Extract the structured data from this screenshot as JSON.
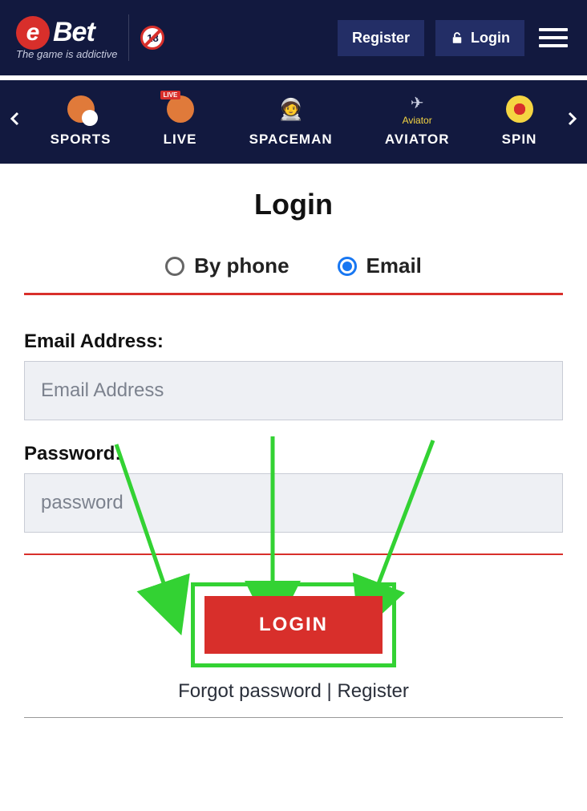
{
  "header": {
    "brand_letter": "e",
    "brand_word": "Bet",
    "brand_tagline": "The game is addictive",
    "age_badge": "18",
    "register_label": "Register",
    "login_label": "Login"
  },
  "nav": {
    "items": [
      {
        "label": "SPORTS"
      },
      {
        "label": "LIVE",
        "live_tag": "LIVE"
      },
      {
        "label": "SPACEMAN"
      },
      {
        "label": "AVIATOR",
        "brand": "Aviator"
      },
      {
        "label": "SPIN"
      }
    ]
  },
  "page": {
    "title": "Login",
    "tabs": {
      "by_phone": "By phone",
      "email": "Email",
      "selected": "email"
    },
    "form": {
      "email_label": "Email Address:",
      "email_placeholder": "Email Address",
      "password_label": "Password:",
      "password_placeholder": "password"
    },
    "login_button": "LOGIN",
    "links": {
      "forgot": "Forgot password",
      "sep": " | ",
      "register": "Register"
    }
  },
  "colors": {
    "accent_red": "#d82f2b",
    "bg_navy": "#12193f",
    "annot_green": "#33d233",
    "radio_blue": "#1877f2"
  }
}
